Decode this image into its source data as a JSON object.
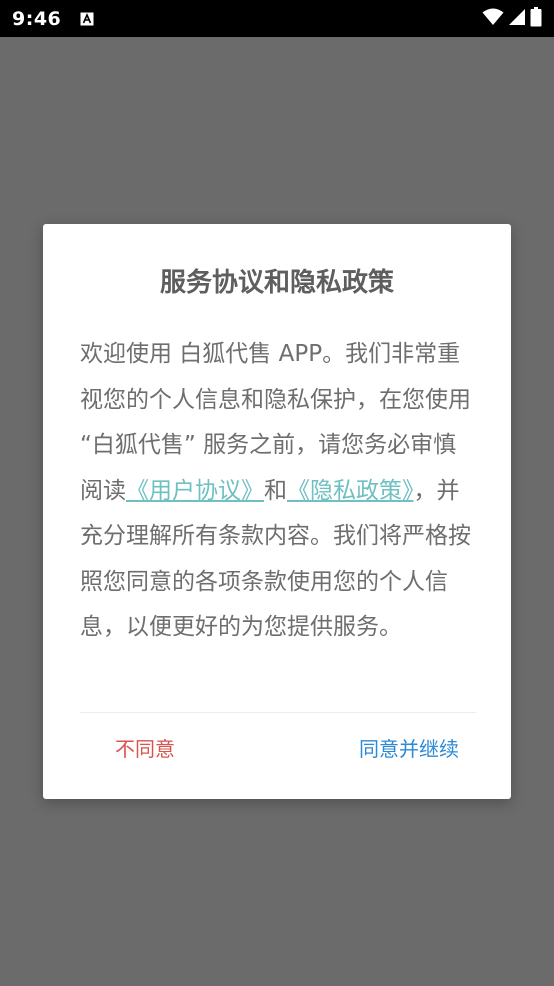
{
  "status_bar": {
    "time": "9:46",
    "icons": [
      "font-a-icon",
      "wifi-icon",
      "signal-icon",
      "battery-icon"
    ]
  },
  "dialog": {
    "title": "服务协议和隐私政策",
    "body": {
      "part1": "欢迎使用 白狐代售 APP。我们非常重视您的个人信息和隐私保护，在您使用 “白狐代售” 服务之前，请您务必审慎阅读",
      "link_user_agreement": "《用户协议》",
      "conjunction": "和",
      "link_privacy_policy": "《隐私政策》",
      "part2": "，并充分理解所有条款内容。我们将严格按照您同意的各项条款使用您的个人信息，以便更好的为您提供服务。"
    },
    "buttons": {
      "disagree": "不同意",
      "agree": "同意并继续"
    }
  },
  "colors": {
    "overlay": "#6b6b6b",
    "link": "#6fc0c2",
    "disagree": "#d9534f",
    "agree": "#2b8ad6"
  }
}
